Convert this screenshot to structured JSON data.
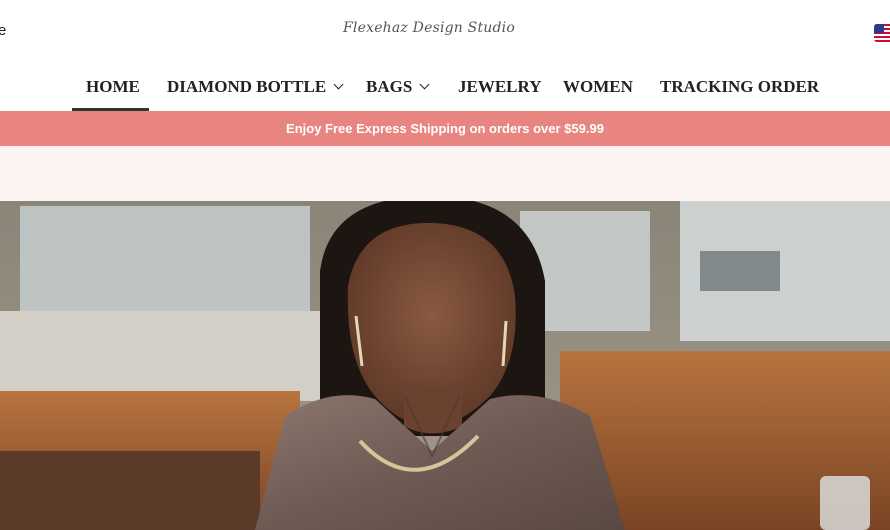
{
  "header": {
    "left_fragment": "e",
    "logo_text": "Flexehaz Design Studio",
    "flag_icon": "us-flag-icon"
  },
  "nav": {
    "items": [
      {
        "label": "HOME",
        "active": true,
        "has_dropdown": false
      },
      {
        "label": "DIAMOND BOTTLE",
        "active": false,
        "has_dropdown": true
      },
      {
        "label": "BAGS",
        "active": false,
        "has_dropdown": true
      },
      {
        "label": "JEWELRY",
        "active": false,
        "has_dropdown": false
      },
      {
        "label": "WOMEN",
        "active": false,
        "has_dropdown": false
      },
      {
        "label": "TRACKING ORDER",
        "active": false,
        "has_dropdown": false
      }
    ]
  },
  "promo": {
    "text": "Enjoy Free Express Shipping on orders over $59.99",
    "background": "#e88580"
  },
  "hero": {
    "image": "hero-model-photo"
  }
}
